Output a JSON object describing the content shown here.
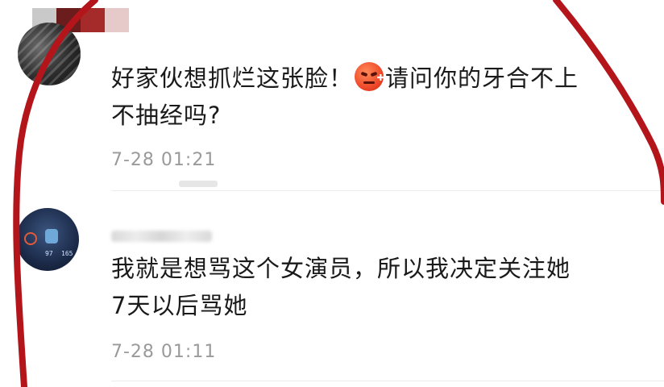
{
  "comments": [
    {
      "text_line1": "好家伙想抓烂这张脸！",
      "text_line2": "请问你的牙合不上",
      "text_line3": "不抽经吗?",
      "emoji": "angry-face-emoji",
      "time": "7-28 01:21"
    },
    {
      "text_line1": "我就是想骂这个女演员，所以我决定关注她",
      "text_line2": "7天以后骂她",
      "time": "7-28 01:11",
      "avatar_stats": [
        "97",
        "165"
      ]
    }
  ],
  "colors": {
    "annotation_stroke": "#b3151b",
    "mosaic": [
      "#7b1e1e",
      "#b33a3a",
      "#d98a8a",
      "#ffffff"
    ],
    "time_text": "#9a9a9a"
  }
}
